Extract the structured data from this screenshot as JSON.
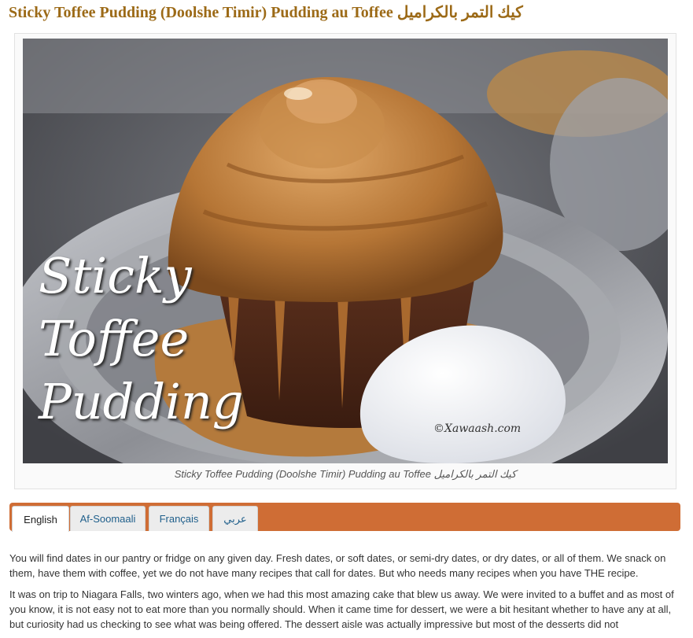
{
  "page": {
    "title": "Sticky Toffee Pudding (Doolshe Timir) Pudding au Toffee كيك التمر بالكراميل"
  },
  "figure": {
    "overlay_lines": [
      "Sticky",
      "Toffee",
      "Pudding"
    ],
    "watermark": "©Xawaash.com",
    "caption": "Sticky Toffee Pudding (Doolshe Timir) Pudding au Toffee كيك التمر بالكراميل"
  },
  "tabs": [
    {
      "label": "English",
      "active": true
    },
    {
      "label": "Af-Soomaali",
      "active": false
    },
    {
      "label": "Français",
      "active": false
    },
    {
      "label": "عربي",
      "active": false
    }
  ],
  "content": {
    "paragraphs": [
      "You will find dates in our pantry or fridge on any given day. Fresh dates, or soft dates, or semi-dry dates, or dry dates, or all of them. We snack on them, have them with coffee, yet we do not have many recipes that call for dates. But who needs many recipes when you have THE recipe.",
      "It was on trip to Niagara Falls, two winters ago, when we had this most amazing cake that blew us away. We were invited to a buffet and as most of you know, it is not easy not to eat more than you normally should. When it came time for dessert, we were a bit hesitant whether to have any at all, but curiosity had us checking to see what was being offered. The dessert aisle was actually impressive but most of the desserts did not"
    ]
  },
  "colors": {
    "title": "#9c6a17",
    "tab_bar": "#cf6d35",
    "tab_link": "#1f5f8b"
  }
}
